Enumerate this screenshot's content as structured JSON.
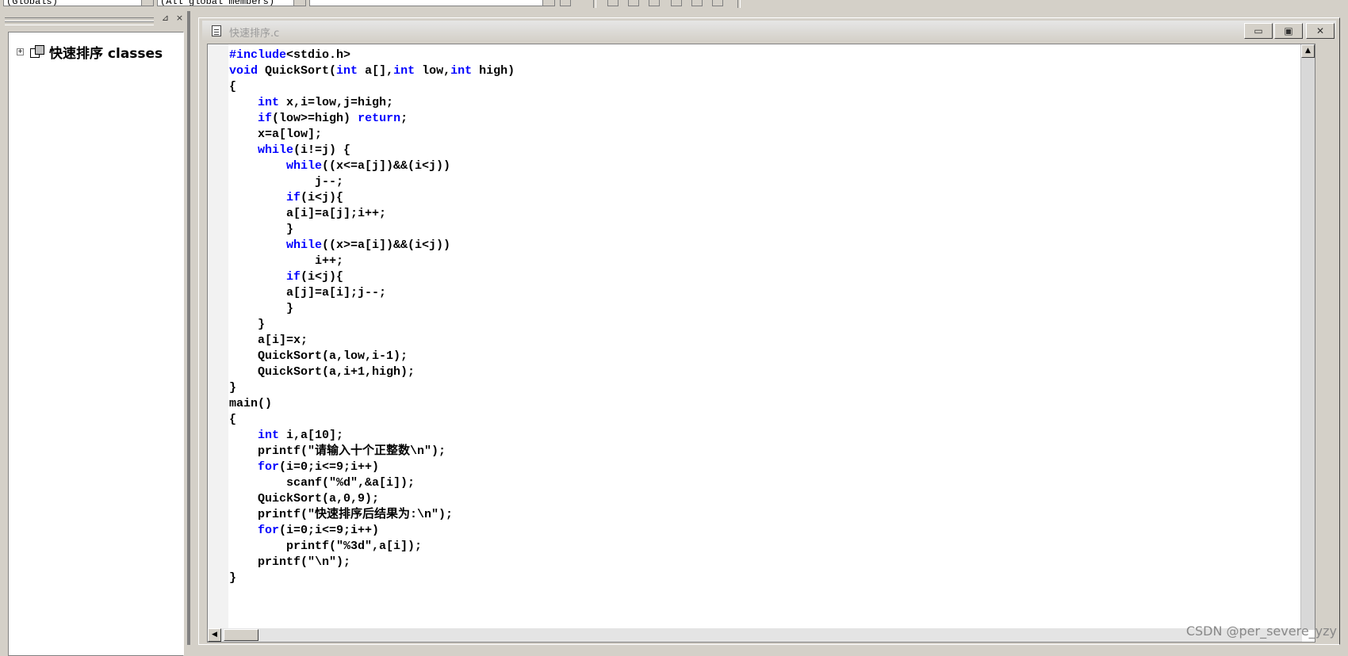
{
  "toolbar": {
    "combo1": "(Globals)",
    "combo2": "(All global members)",
    "combo3": ""
  },
  "classview": {
    "expander": "+",
    "root_label": "快速排序 classes",
    "pin_glyph": "⊿",
    "close_glyph": "×"
  },
  "document": {
    "title": "快速排序.c",
    "minimize_glyph": "▭",
    "restore_glyph": "▣",
    "close_glyph": "✕"
  },
  "scroll": {
    "up_glyph": "▲",
    "left_glyph": "◀"
  },
  "code_lines": [
    "#include<stdio.h>",
    "void QuickSort(int a[],int low,int high)",
    "{",
    "    int x,i=low,j=high;",
    "    if(low>=high) return;",
    "    x=a[low];",
    "    while(i!=j) {",
    "        while((x<=a[j])&&(i<j))",
    "            j--;",
    "        if(i<j){",
    "        a[i]=a[j];i++;",
    "        }",
    "        while((x>=a[i])&&(i<j))",
    "            i++;",
    "        if(i<j){",
    "        a[j]=a[i];j--;",
    "        }",
    "    }",
    "    a[i]=x;",
    "    QuickSort(a,low,i-1);",
    "    QuickSort(a,i+1,high);",
    "}",
    "main()",
    "{",
    "    int i,a[10];",
    "    printf(\"请输入十个正整数\\n\");",
    "    for(i=0;i<=9;i++)",
    "        scanf(\"%d\",&a[i]);",
    "    QuickSort(a,0,9);",
    "    printf(\"快速排序后结果为:\\n\");",
    "    for(i=0;i<=9;i++)",
    "        printf(\"%3d\",a[i]);",
    "    printf(\"\\n\");",
    "}"
  ],
  "watermark": "CSDN @per_severe_yzy",
  "colors": {
    "keyword": "#0000ff",
    "text": "#000000"
  }
}
